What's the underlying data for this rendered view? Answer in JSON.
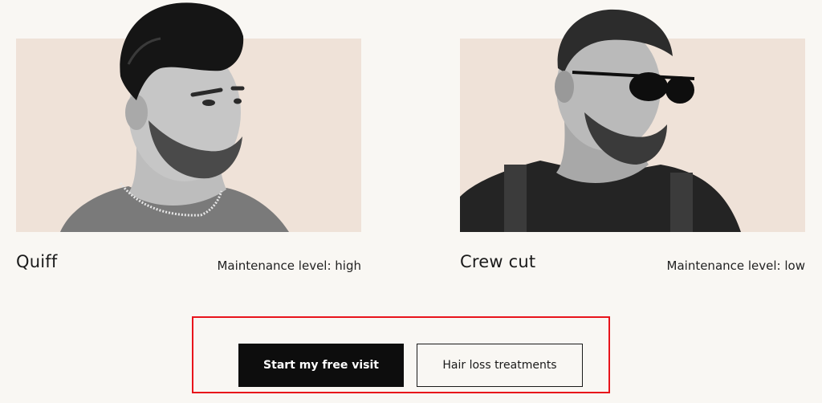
{
  "styles": [
    {
      "name": "Quiff",
      "maintenance": "Maintenance level: high"
    },
    {
      "name": "Crew cut",
      "maintenance": "Maintenance level: low"
    }
  ],
  "cta": {
    "primary_label": "Start my free visit",
    "secondary_label": "Hair loss treatments"
  },
  "colors": {
    "page_background": "#f9f7f3",
    "photo_background": "#efe2d8",
    "primary_button": "#0d0d0d",
    "highlight_outline": "#e8141b"
  }
}
